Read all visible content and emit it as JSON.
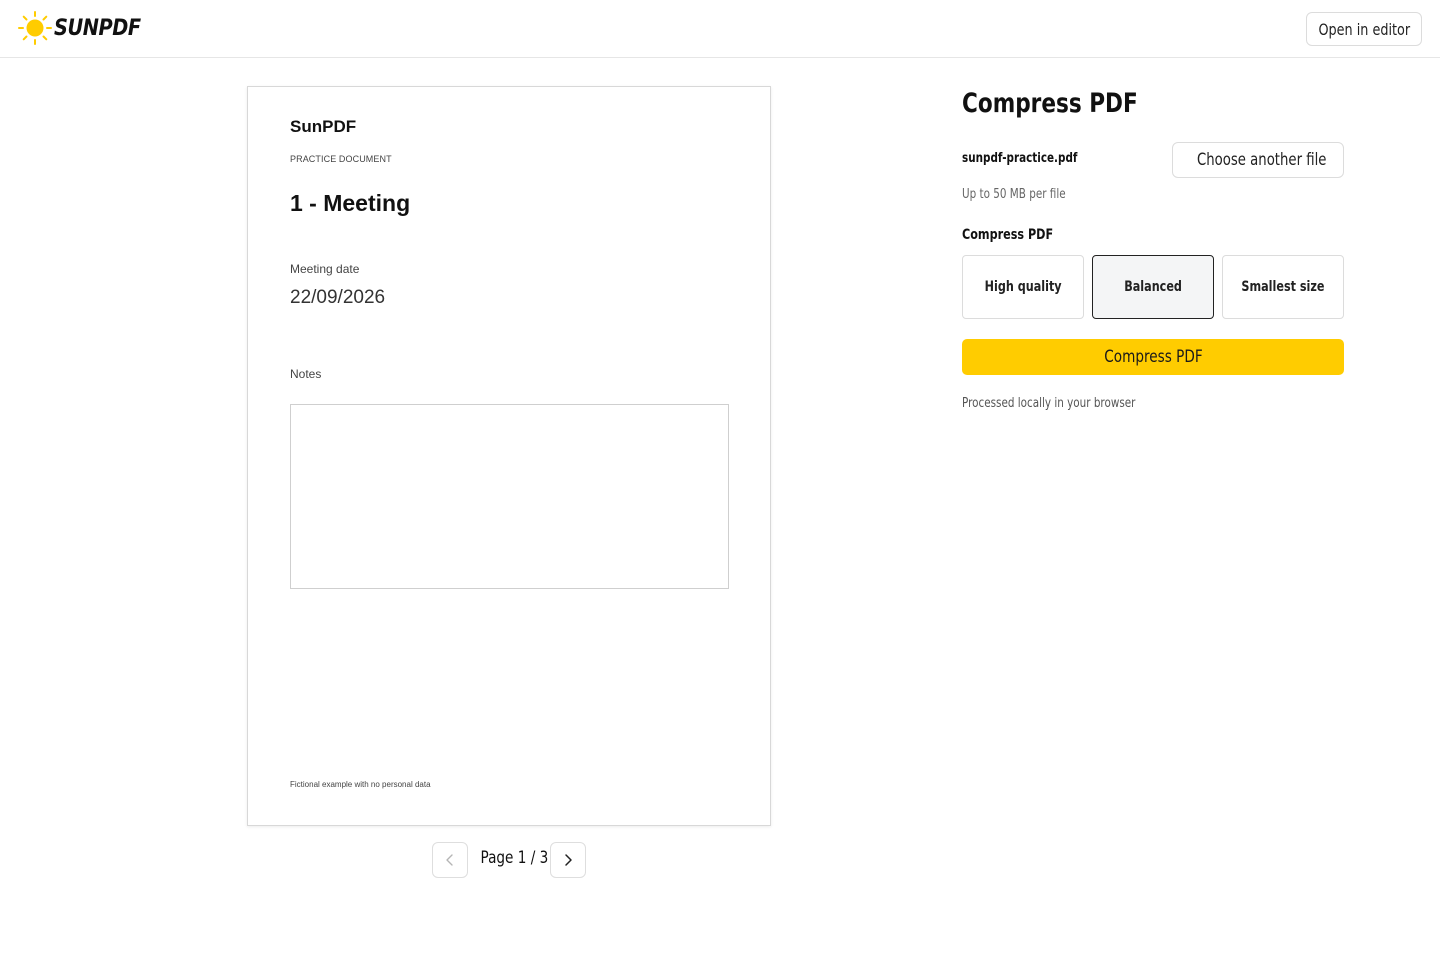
{
  "header": {
    "brand": "SUNPDF",
    "open_editor_label": "Open in editor"
  },
  "document": {
    "brand": "SunPDF",
    "kicker": "PRACTICE DOCUMENT",
    "title": "1 - Meeting",
    "date_label": "Meeting date",
    "date_value": "22/09/2026",
    "notes_label": "Notes",
    "notes_value": "",
    "footer": "Fictional example with no personal data"
  },
  "pager": {
    "label": "Page 1 / 3",
    "current_page": 1,
    "total_pages": 3
  },
  "panel": {
    "title": "Compress PDF",
    "file_name": "sunpdf-practice.pdf",
    "choose_label": "Choose another file",
    "file_limit": "Up to 50 MB per file",
    "options_label": "Compress PDF",
    "options": [
      {
        "label": "High quality",
        "selected": false
      },
      {
        "label": "Balanced",
        "selected": true
      },
      {
        "label": "Smallest size",
        "selected": false
      }
    ],
    "compress_label": "Compress PDF",
    "local_note": "Processed locally in your browser"
  },
  "colors": {
    "accent": "#ffcc00",
    "sun": "#ffcc00",
    "text": "#111111",
    "border": "#dcdcdc"
  }
}
